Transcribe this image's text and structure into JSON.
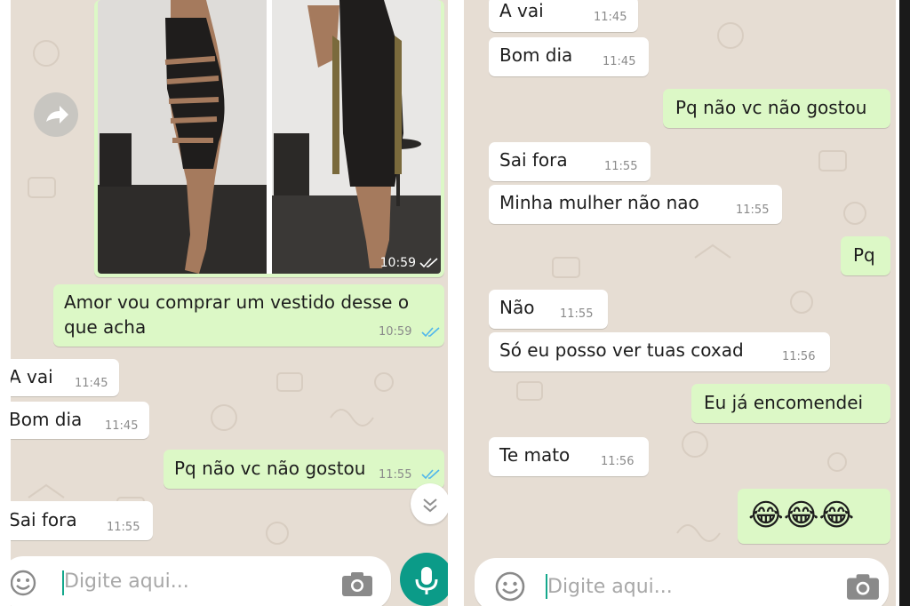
{
  "colors": {
    "wallpaper": "#e6ddd3",
    "incoming_bubble": "#ffffff",
    "outgoing_bubble": "#dcf8c6",
    "read_ticks": "#4fb6ec",
    "mic_button": "#0b9b88",
    "caret": "#14a88c"
  },
  "left": {
    "image_message": {
      "time": "10:59",
      "status": "read"
    },
    "messages": [
      {
        "line1": "Amor vou comprar um vestido desse o",
        "line2": "que acha",
        "time": "10:59"
      },
      {
        "text": "A vai",
        "time": "11:45"
      },
      {
        "text": "Bom dia",
        "time": "11:45"
      },
      {
        "text": "Pq não vc não gostou",
        "time": "11:55"
      },
      {
        "text": "Sai fora",
        "time": "11:55"
      }
    ],
    "input_placeholder": "Digite aqui..."
  },
  "right": {
    "messages": [
      {
        "text": "A vai",
        "time": "11:45"
      },
      {
        "text": "Bom dia",
        "time": "11:45"
      },
      {
        "text": "Pq não vc não gostou"
      },
      {
        "text": "Sai fora",
        "time": "11:55"
      },
      {
        "text": "Minha mulher não nao",
        "time": "11:55"
      },
      {
        "text": "Pq"
      },
      {
        "text": "Não",
        "time": "11:55"
      },
      {
        "text": "Só eu posso ver tuas coxad",
        "time": "11:56"
      },
      {
        "text": "Eu já encomendei"
      },
      {
        "text": "Te mato",
        "time": "11:56"
      },
      {
        "text": "😂😂😂"
      }
    ],
    "input_placeholder": "Digite aqui..."
  },
  "icons": {
    "forward": "forward-icon",
    "scroll_down": "chevron-down-icon",
    "emoji": "emoji-icon",
    "camera": "camera-icon",
    "mic": "mic-icon",
    "read_ticks": "double-check-icon"
  }
}
